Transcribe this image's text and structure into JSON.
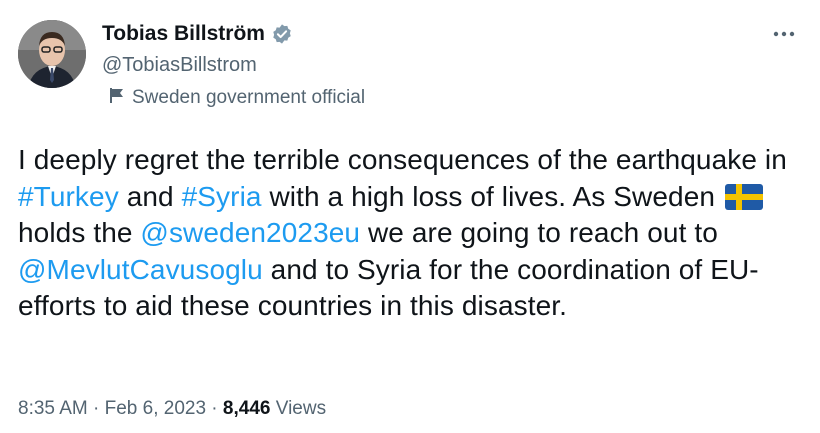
{
  "author": {
    "display_name": "Tobias Billström",
    "handle": "@TobiasBillstrom",
    "label": "Sweden government official"
  },
  "icons": {
    "verified": "verified-badge-icon",
    "label": "government-label-icon",
    "more": "more-options-icon",
    "flag": "sweden-flag-icon"
  },
  "colors": {
    "link": "#1d9bf0",
    "verified_badge": "#829aab",
    "flag_blue": "#1f5aa6",
    "flag_yellow": "#f3c300"
  },
  "tweet": {
    "text_1": "I deeply regret the terrible consequences of the earthquake in ",
    "hashtag_turkey": "#Turkey",
    "text_2": " and ",
    "hashtag_syria": "#Syria",
    "text_3": " with a high loss of lives. As Sweden ",
    "text_4": " holds the ",
    "mention_sweden": "@sweden2023eu",
    "text_5": " we are going to reach out to ",
    "mention_mevlut": "@MevlutCavusoglu",
    "text_6": " and to Syria for the coordination of EU-efforts to aid these countries in this disaster."
  },
  "meta": {
    "time": "8:35 AM",
    "sep1": " · ",
    "date": "Feb 6, 2023",
    "sep2": " · ",
    "views_count": "8,446",
    "views_label": " Views"
  }
}
